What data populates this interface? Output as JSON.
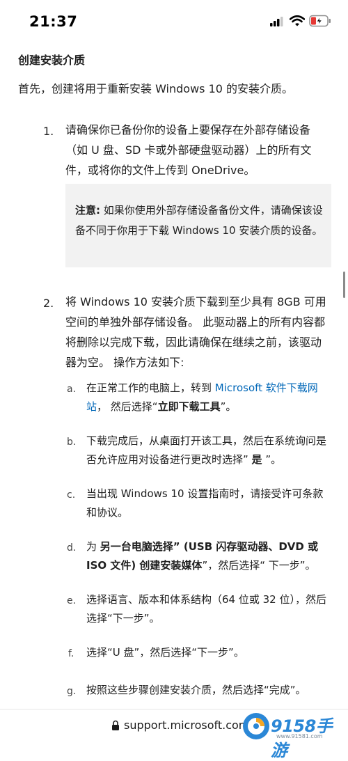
{
  "status_bar": {
    "time": "21:37"
  },
  "article": {
    "section_title": "创建安装介质",
    "intro": "首先，创建将用于重新安装 Windows 10 的安装介质。",
    "steps": [
      {
        "number": "1.",
        "text": "请确保你已备份你的设备上要保存在外部存储设备（如 U 盘、SD 卡或外部硬盘驱动器）上的所有文件，或将你的文件上传到 OneDrive。"
      },
      {
        "number": "2.",
        "text": "将 Windows 10 安装介质下载到至少具有 8GB 可用空间的单独外部存储设备。 此驱动器上的所有内容都将删除以完成下载，因此请确保在继续之前，该驱动器为空。 操作方法如下:"
      }
    ],
    "note": {
      "label": "注意:",
      "text": " 如果你使用外部存储设备备份文件，请确保该设备不同于你用于下载 Windows 10 安装介质的设备。"
    },
    "substeps": [
      {
        "letter": "a.",
        "pre": "在正常工作的电脑上，转到 ",
        "link": "Microsoft 软件下载网站",
        "mid": "， 然后选择“",
        "bold": "立即下载工具",
        "post": "”。"
      },
      {
        "letter": "b.",
        "pre": "下载完成后，从桌面打开该工具，然后在系统询问是否允许应用对设备进行更改时选择” ",
        "bold": "是",
        "post": " ”。"
      },
      {
        "letter": "c.",
        "pre": "当出现 Windows 10 设置指南时，请接受许可条款和协议。"
      },
      {
        "letter": "d.",
        "pre": "为 ",
        "bold": "另一台电脑选择” (USB 闪存驱动器、DVD 或 ISO 文件) 创建安装媒体",
        "post": "”，然后选择“ 下一步”。"
      },
      {
        "letter": "e.",
        "pre": "选择语言、版本和体系结构（64 位或 32 位），然后选择“下一步”。"
      },
      {
        "letter": "f.",
        "pre": "选择“U 盘”，然后选择“下一步”。"
      },
      {
        "letter": "g.",
        "pre": "按照这些步骤创建安装介质，然后选择“完成”。"
      }
    ]
  },
  "browser": {
    "url": "support.microsoft.com"
  },
  "watermark": {
    "brand": "9158手游",
    "site": "www.91581.com"
  },
  "colors": {
    "link": "#0067b8",
    "note_bg": "#f2f2f2",
    "battery": "#e53935"
  },
  "icons": [
    "cellular-signal-icon",
    "wifi-icon",
    "battery-charging-icon",
    "lock-icon"
  ]
}
